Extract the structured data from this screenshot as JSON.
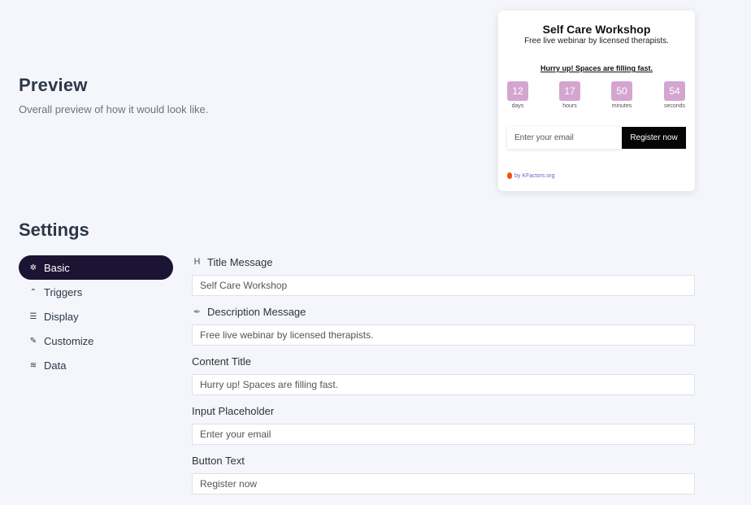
{
  "preview": {
    "title": "Preview",
    "subtitle": "Overall preview of how it would look like."
  },
  "widget": {
    "title": "Self Care Workshop",
    "description": "Free live webinar by licensed therapists.",
    "content_title": "Hurry up! Spaces are filling fast.",
    "countdown": [
      {
        "value": "12",
        "label": "days"
      },
      {
        "value": "17",
        "label": "hours"
      },
      {
        "value": "50",
        "label": "minutes"
      },
      {
        "value": "54",
        "label": "seconds"
      }
    ],
    "input_placeholder": "Enter your email",
    "button_text": "Register now",
    "credit": "by KFactors.org",
    "colors": {
      "countdown_box": "#d4a5d0",
      "button": "#050505",
      "credit": "#7c5cc4"
    }
  },
  "settings": {
    "title": "Settings",
    "nav": [
      {
        "label": "Basic",
        "icon": "gear-icon",
        "glyph": "✲",
        "active": true
      },
      {
        "label": "Triggers",
        "icon": "chevron-up-icon",
        "glyph": "⌃",
        "active": false
      },
      {
        "label": "Display",
        "icon": "sliders-icon",
        "glyph": "☰",
        "active": false
      },
      {
        "label": "Customize",
        "icon": "brush-icon",
        "glyph": "✎",
        "active": false
      },
      {
        "label": "Data",
        "icon": "database-icon",
        "glyph": "≋",
        "active": false
      }
    ],
    "fields": [
      {
        "label": "Title Message",
        "icon": "heading-icon",
        "glyph": "H",
        "value": "Self Care Workshop"
      },
      {
        "label": "Description Message",
        "icon": "feather-icon",
        "glyph": "✒",
        "value": "Free live webinar by licensed therapists."
      },
      {
        "label": "Content Title",
        "icon": "",
        "glyph": "",
        "value": "Hurry up! Spaces are filling fast."
      },
      {
        "label": "Input Placeholder",
        "icon": "",
        "glyph": "",
        "value": "Enter your email"
      },
      {
        "label": "Button Text",
        "icon": "",
        "glyph": "",
        "value": "Register now"
      }
    ],
    "active_color": "#1c1433"
  }
}
